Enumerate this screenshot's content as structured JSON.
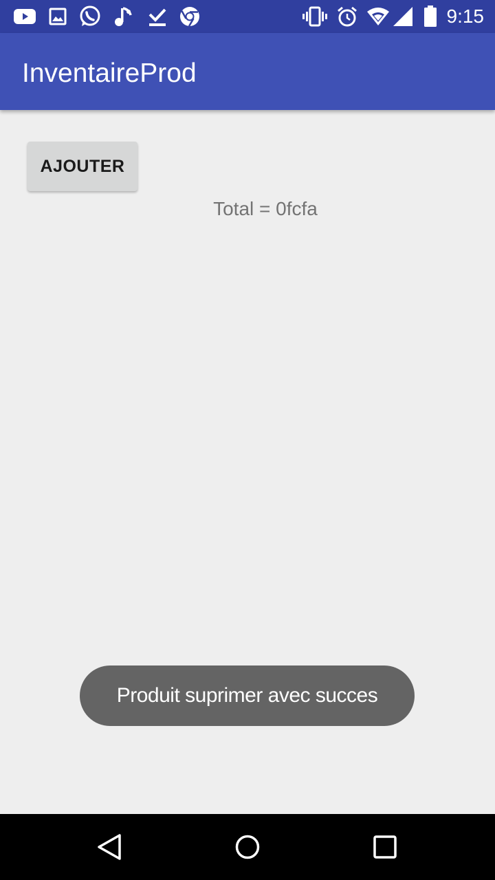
{
  "status_bar": {
    "time": "9:15",
    "notification_icons": [
      "youtube-icon",
      "gallery-icon",
      "whatsapp-icon",
      "music-note-icon",
      "download-done-icon",
      "chrome-icon"
    ],
    "system_icons": [
      "vibrate-icon",
      "alarm-icon",
      "wifi-icon",
      "cell-signal-icon",
      "battery-icon"
    ],
    "color": "#303f9f"
  },
  "app_bar": {
    "title": "InventaireProd",
    "color": "#3f51b5"
  },
  "main": {
    "add_button_label": "AJOUTER",
    "total_text": "Total = 0fcfa"
  },
  "toast": {
    "message": "Produit suprimer avec succes"
  },
  "nav_bar": {
    "buttons": [
      "back-icon",
      "home-icon",
      "recents-icon"
    ]
  }
}
